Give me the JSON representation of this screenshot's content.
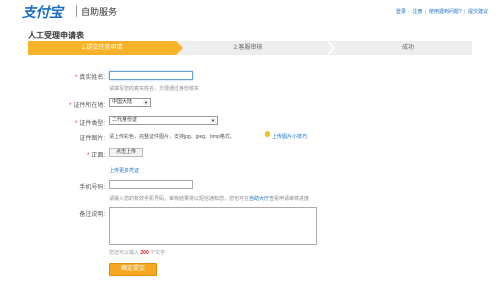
{
  "header": {
    "logo": "支付宝",
    "service": "自助服务",
    "links": [
      "登录",
      "注册",
      "使用遇到问题?",
      "提交建议"
    ]
  },
  "page": {
    "title": "人工受理申请表"
  },
  "steps": [
    "1.提交任务申请",
    "2.客服审核",
    "成功"
  ],
  "form": {
    "real_name": {
      "label": "真实姓名:",
      "hint": "请填写您的真实姓名，方便通过身份核实"
    },
    "region": {
      "label": "证件所在地:",
      "value": "中国大陆"
    },
    "id_type": {
      "label": "证件类型:",
      "value": "二代身份证"
    },
    "id_image": {
      "label": "证件图片:",
      "hint": "请上传彩色，完整证件图片，支持jpg、jpeg、bmp格式。",
      "tip_link": "上传图片小技巧"
    },
    "front": {
      "label": "正面:",
      "button": "点击上传"
    },
    "more_link": "上传更多凭证",
    "phone": {
      "label": "手机号码:",
      "hint": "请输入您的有效手机号码，审核结果将以短信通知您，您也可在",
      "hint_link": "自助大厅",
      "hint_tail": "查看申请审核进度"
    },
    "remarks": {
      "label": "备注说明:",
      "count_prefix": "您还可以输入",
      "count_value": "200",
      "count_suffix": "个文字"
    },
    "submit_label": "确定提交"
  },
  "colors": {
    "accent": "#f9b32a",
    "link": "#1a6fc4",
    "required": "#e02020"
  }
}
